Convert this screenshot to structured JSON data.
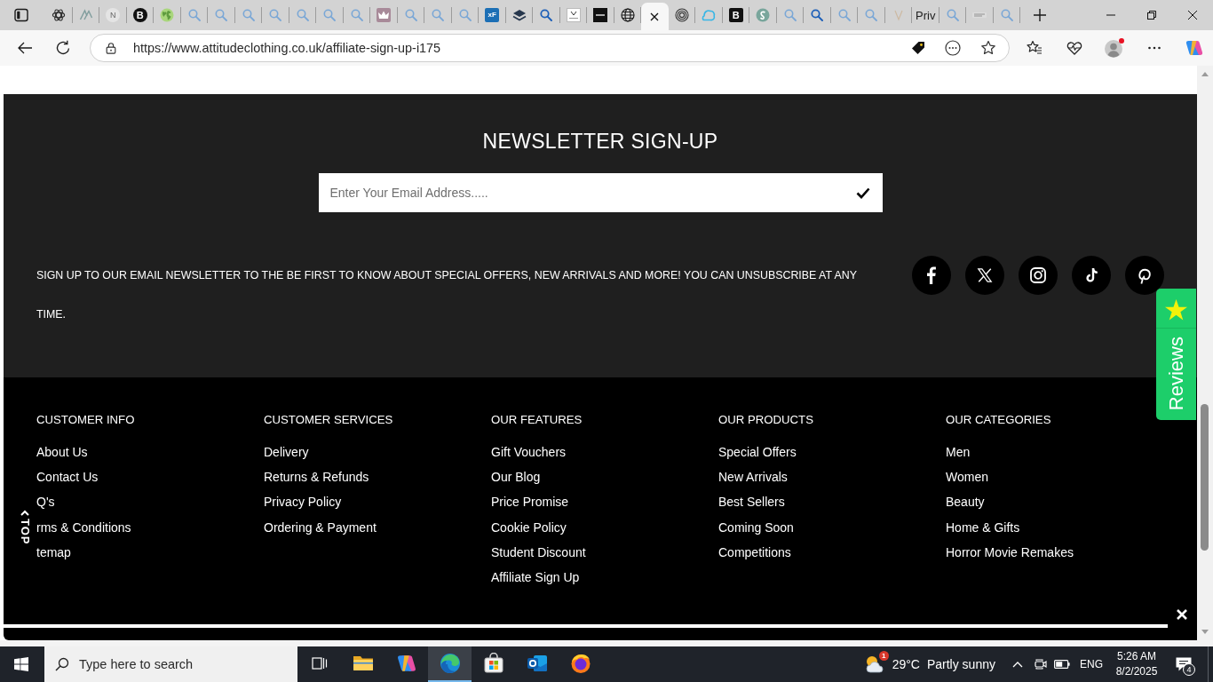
{
  "browser": {
    "tabs": [
      {
        "kind": "knot",
        "selected": false
      },
      {
        "kind": "zigzag",
        "selected": false
      },
      {
        "kind": "letter-circle",
        "glyph": "N",
        "selected": false
      },
      {
        "kind": "letter-circle-dark",
        "glyph": "B",
        "selected": false
      },
      {
        "kind": "green-globe",
        "selected": false
      },
      {
        "kind": "search",
        "selected": false
      },
      {
        "kind": "search",
        "selected": false
      },
      {
        "kind": "search",
        "selected": false
      },
      {
        "kind": "search",
        "selected": false
      },
      {
        "kind": "search",
        "selected": false
      },
      {
        "kind": "search",
        "selected": false
      },
      {
        "kind": "search",
        "selected": false
      },
      {
        "kind": "crown",
        "selected": false
      },
      {
        "kind": "search",
        "selected": false
      },
      {
        "kind": "search",
        "selected": false
      },
      {
        "kind": "search",
        "selected": false
      },
      {
        "kind": "letter-tile",
        "glyph": "xF",
        "selected": false
      },
      {
        "kind": "layers",
        "selected": false
      },
      {
        "kind": "search-strong",
        "selected": false
      },
      {
        "kind": "thumbnail",
        "selected": false
      },
      {
        "kind": "dark-thumbnail",
        "selected": false
      },
      {
        "kind": "globe",
        "selected": false
      },
      {
        "selected": true
      },
      {
        "kind": "rings",
        "selected": false
      },
      {
        "kind": "cloud",
        "selected": false
      },
      {
        "kind": "letter-tile-dark",
        "glyph": "B",
        "selected": false
      },
      {
        "kind": "swirl",
        "selected": false
      },
      {
        "kind": "search",
        "selected": false
      },
      {
        "kind": "search-strong",
        "selected": false
      },
      {
        "kind": "search",
        "selected": false
      },
      {
        "kind": "search",
        "selected": false
      },
      {
        "kind": "v-mark",
        "selected": false
      },
      {
        "kind": "text",
        "label": "Priv",
        "selected": false
      },
      {
        "kind": "search",
        "selected": false
      },
      {
        "kind": "wordmark",
        "selected": false
      },
      {
        "kind": "search",
        "selected": false
      }
    ],
    "address_bar": {
      "url": "https://www.attitudeclothing.co.uk/affiliate-sign-up-i175"
    }
  },
  "newsletter": {
    "title": "NEWSLETTER SIGN-UP",
    "email_field": {
      "placeholder": "Enter Your Email Address....."
    },
    "message": "SIGN UP TO OUR EMAIL NEWSLETTER TO THE BE FIRST TO KNOW ABOUT SPECIAL OFFERS, NEW ARRIVALS AND MORE! YOU CAN UNSUBSCRIBE AT ANY TIME.",
    "social_links": [
      {
        "kind": "facebook"
      },
      {
        "kind": "x"
      },
      {
        "kind": "instagram"
      },
      {
        "kind": "tiktok"
      },
      {
        "kind": "pinterest"
      }
    ]
  },
  "reviews_tab": {
    "label": "Reviews"
  },
  "back_to_top": {
    "label": "TOP"
  },
  "footer": {
    "columns": [
      {
        "heading": "CUSTOMER INFO",
        "links": [
          "About Us",
          "Contact Us",
          "Q's",
          "rms & Conditions",
          "temap"
        ]
      },
      {
        "heading": "CUSTOMER SERVICES",
        "links": [
          "Delivery",
          "Returns & Refunds",
          "Privacy Policy",
          "Ordering & Payment"
        ]
      },
      {
        "heading": "OUR FEATURES",
        "links": [
          "Gift Vouchers",
          "Our Blog",
          "Price Promise",
          "Cookie Policy",
          "Student Discount",
          "Affiliate Sign Up"
        ]
      },
      {
        "heading": "OUR PRODUCTS",
        "links": [
          "Special Offers",
          "New Arrivals",
          "Best Sellers",
          "Coming Soon",
          "Competitions"
        ]
      },
      {
        "heading": "OUR CATEGORIES",
        "links": [
          "Men",
          "Women",
          "Beauty",
          "Home & Gifts",
          "Horror Movie Remakes"
        ]
      }
    ]
  },
  "taskbar": {
    "search": {
      "placeholder": "Type here to search"
    },
    "apps": [
      {
        "kind": "task-view",
        "selected": false
      },
      {
        "kind": "folder",
        "selected": false
      },
      {
        "kind": "copilot",
        "selected": false
      },
      {
        "kind": "edge",
        "selected": true
      },
      {
        "kind": "store",
        "selected": false
      },
      {
        "kind": "outlook",
        "selected": false
      },
      {
        "kind": "firefox",
        "selected": false
      }
    ],
    "weather": {
      "alert_count": "1",
      "temperature": "29°C",
      "condition": "Partly sunny"
    },
    "language": "ENG",
    "time": "5:26 AM",
    "date": "8/2/2025",
    "notification_count": "4"
  }
}
